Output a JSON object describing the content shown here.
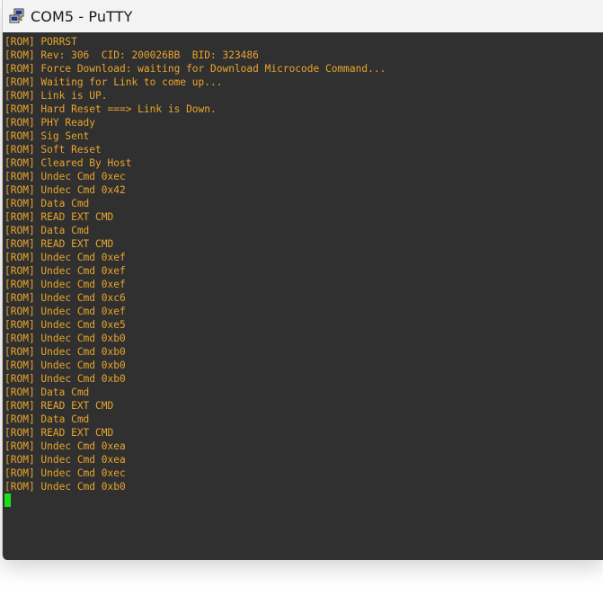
{
  "window": {
    "title": "COM5 - PuTTY",
    "icon": "putty-icon"
  },
  "terminal": {
    "text_color": "#e8a52c",
    "background": "#303030",
    "cursor_color": "#18e018",
    "lines": [
      "[ROM] PORRST",
      "[ROM] Rev: 306  CID: 200026BB  BID: 323486",
      "[ROM] Force Download: waiting for Download Microcode Command...",
      "[ROM] Waiting for Link to come up...",
      "[ROM] Link is UP.",
      "[ROM] Hard Reset ===> Link is Down.",
      "[ROM] PHY Ready",
      "[ROM] Sig Sent",
      "[ROM] Soft Reset",
      "[ROM] Cleared By Host",
      "[ROM] Undec Cmd 0xec",
      "[ROM] Undec Cmd 0x42",
      "[ROM] Data Cmd",
      "[ROM] READ EXT CMD",
      "[ROM] Data Cmd",
      "[ROM] READ EXT CMD",
      "[ROM] Undec Cmd 0xef",
      "[ROM] Undec Cmd 0xef",
      "[ROM] Undec Cmd 0xef",
      "[ROM] Undec Cmd 0xc6",
      "[ROM] Undec Cmd 0xef",
      "[ROM] Undec Cmd 0xe5",
      "[ROM] Undec Cmd 0xb0",
      "[ROM] Undec Cmd 0xb0",
      "[ROM] Undec Cmd 0xb0",
      "[ROM] Undec Cmd 0xb0",
      "[ROM] Data Cmd",
      "[ROM] READ EXT CMD",
      "[ROM] Data Cmd",
      "[ROM] READ EXT CMD",
      "[ROM] Undec Cmd 0xea",
      "[ROM] Undec Cmd 0xea",
      "[ROM] Undec Cmd 0xec",
      "[ROM] Undec Cmd 0xb0"
    ]
  }
}
